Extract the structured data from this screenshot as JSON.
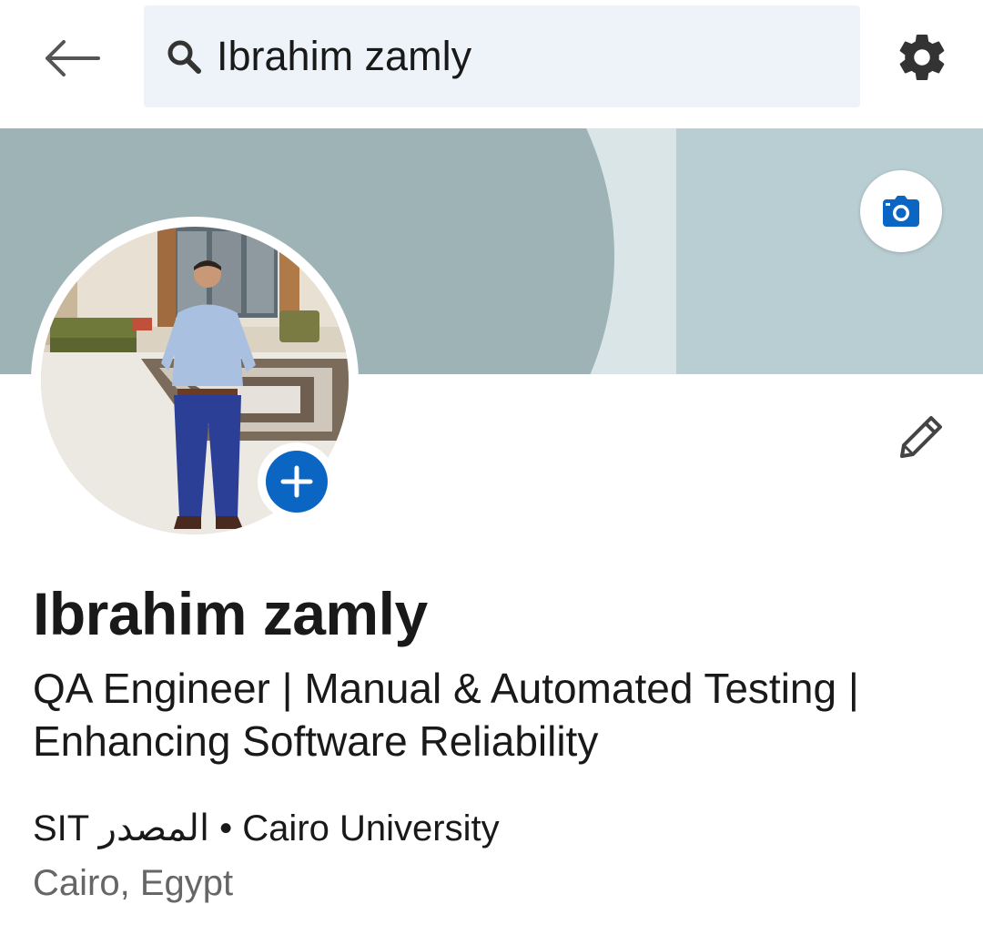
{
  "search": {
    "query": "Ibrahim zamly"
  },
  "icons": {
    "back": "arrow-left-icon",
    "search": "search-icon",
    "settings": "gear-icon",
    "camera": "camera-icon",
    "add_photo": "plus-icon",
    "edit": "pencil-icon"
  },
  "profile": {
    "name": "Ibrahim zamly",
    "headline": "QA Engineer | Manual & Automated Testing | Enhancing Software Reliability",
    "education": "SIT المصدر • Cairo University",
    "location": "Cairo, Egypt"
  },
  "colors": {
    "accent": "#0a66c2",
    "search_bg": "#edf3f8",
    "text_primary": "#191919",
    "text_secondary": "#666666",
    "banner_dark": "#9eb3b6",
    "banner_light": "#b9ced2"
  }
}
